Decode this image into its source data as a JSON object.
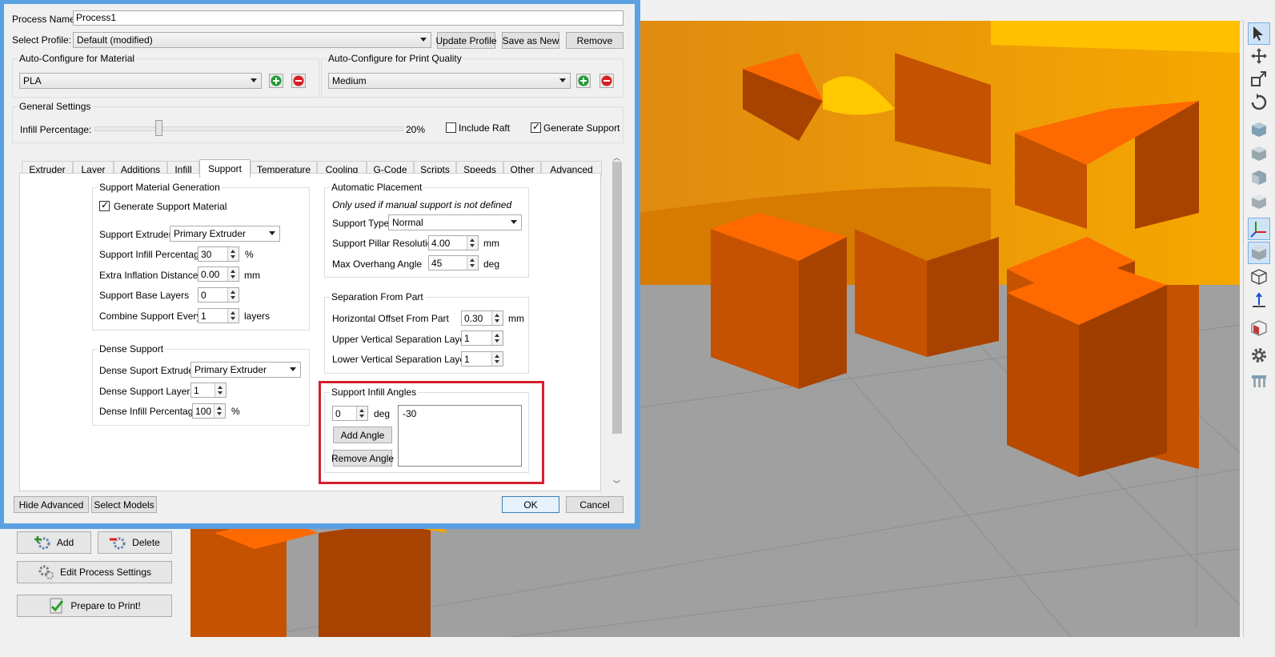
{
  "dialog": {
    "process_name_label": "Process Name:",
    "process_name_value": "Process1",
    "select_profile_label": "Select Profile:",
    "select_profile_value": "Default (modified)",
    "update_profile": "Update Profile",
    "save_as_new": "Save as New",
    "remove": "Remove",
    "material": {
      "title": "Auto-Configure for Material",
      "value": "PLA"
    },
    "quality": {
      "title": "Auto-Configure for Print Quality",
      "value": "Medium"
    },
    "general": {
      "title": "General Settings",
      "infill_label": "Infill Percentage:",
      "infill_value_text": "20%",
      "infill_fraction": 0.2,
      "include_raft": "Include Raft",
      "include_raft_checked": false,
      "generate_support": "Generate Support",
      "generate_support_checked": true
    },
    "tabs": [
      "Extruder",
      "Layer",
      "Additions",
      "Infill",
      "Support",
      "Temperature",
      "Cooling",
      "G-Code",
      "Scripts",
      "Speeds",
      "Other",
      "Advanced"
    ],
    "selected_tab": "Support",
    "support_gen": {
      "title": "Support Material Generation",
      "generate_label": "Generate Support Material",
      "support_extruder_label": "Support Extruder",
      "support_extruder_value": "Primary Extruder",
      "infill_pct_label": "Support Infill Percentage",
      "infill_pct_value": "30",
      "infill_pct_unit": "%",
      "inflation_label": "Extra Inflation Distance",
      "inflation_value": "0.00",
      "inflation_unit": "mm",
      "base_layers_label": "Support Base Layers",
      "base_layers_value": "0",
      "combine_label": "Combine Support Every",
      "combine_value": "1",
      "combine_unit": "layers"
    },
    "dense": {
      "title": "Dense Support",
      "extruder_label": "Dense Suport Extruder",
      "extruder_value": "Primary Extruder",
      "layers_label": "Dense Support Layers",
      "layers_value": "1",
      "infill_label": "Dense Infill Percentage",
      "infill_value": "100",
      "infill_unit": "%"
    },
    "auto_place": {
      "title": "Automatic Placement",
      "note": "Only used if manual support is not defined",
      "type_label": "Support Type",
      "type_value": "Normal",
      "pillar_label": "Support Pillar Resolution",
      "pillar_value": "4.00",
      "pillar_unit": "mm",
      "overhang_label": "Max Overhang Angle",
      "overhang_value": "45",
      "overhang_unit": "deg"
    },
    "separation": {
      "title": "Separation From Part",
      "h_offset_label": "Horizontal Offset From Part",
      "h_offset_value": "0.30",
      "h_offset_unit": "mm",
      "upper_label": "Upper Vertical Separation Layers",
      "upper_value": "1",
      "lower_label": "Lower Vertical Separation Layers",
      "lower_value": "1"
    },
    "angles": {
      "title": "Support Infill Angles",
      "angle_value": "0",
      "angle_unit": "deg",
      "add": "Add Angle",
      "remove": "Remove Angle",
      "list": [
        "-30"
      ]
    },
    "hide_advanced": "Hide Advanced",
    "select_models": "Select Models",
    "ok": "OK",
    "cancel": "Cancel"
  },
  "left_panel": {
    "add": "Add",
    "delete": "Delete",
    "edit_process": "Edit Process Settings",
    "prepare": "Prepare to Print!"
  },
  "toolbar_icons": [
    "select-arrow-icon",
    "move-icon",
    "scale-icon",
    "rotate-icon",
    "iso-view-icon",
    "front-view-icon",
    "side-view-icon",
    "top-view-icon",
    "axis-icon",
    "solid-view-icon",
    "wireframe-view-icon",
    "bed-axis-icon",
    "cross-section-icon",
    "settings-gear-icon",
    "supports-icon"
  ],
  "colors": {
    "model_orange": "#c55a00",
    "model_top": "#ff6a00",
    "model_yellow": "#f6a500",
    "bed_gray": "#a0a0a0",
    "highlight_red": "#d4202c",
    "title_blue": "#5ba1e2"
  }
}
